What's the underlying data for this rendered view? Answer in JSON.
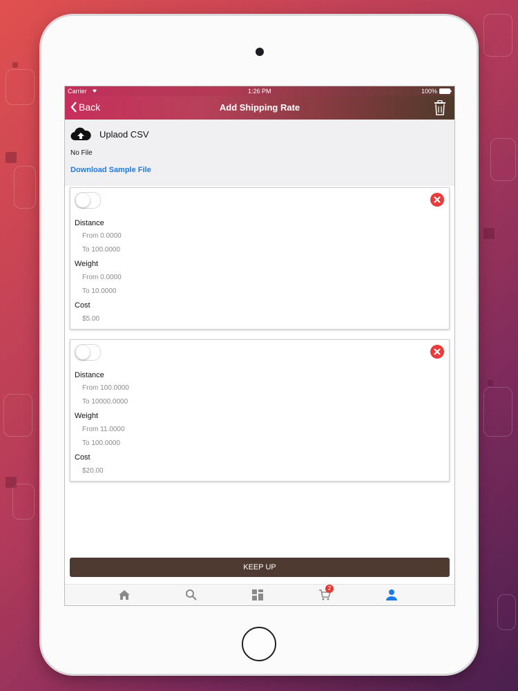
{
  "status_bar": {
    "carrier": "Carrier",
    "time": "1:26 PM",
    "battery": "100%"
  },
  "nav": {
    "back_label": "Back",
    "title": "Add Shipping Rate"
  },
  "upload": {
    "label": "Uplaod CSV",
    "file_status": "No File",
    "download_link": "Download Sample File"
  },
  "rates": [
    {
      "distance_label": "Distance",
      "distance_from": "From 0.0000",
      "distance_to": "To 100.0000",
      "weight_label": "Weight",
      "weight_from": "From 0.0000",
      "weight_to": "To 10.0000",
      "cost_label": "Cost",
      "cost": "$5.00"
    },
    {
      "distance_label": "Distance",
      "distance_from": "From 100.0000",
      "distance_to": "To 10000.0000",
      "weight_label": "Weight",
      "weight_from": "From 11.0000",
      "weight_to": "To 100.0000",
      "cost_label": "Cost",
      "cost": "$20.00"
    }
  ],
  "keep_up_button": "KEEP UP",
  "tabs": {
    "cart_badge": "2"
  },
  "colors": {
    "accent": "#c72f5a",
    "button": "#4e3a30",
    "link": "#1b7ae8",
    "remove": "#ea3a3a",
    "active_tab": "#1b7ae8"
  }
}
